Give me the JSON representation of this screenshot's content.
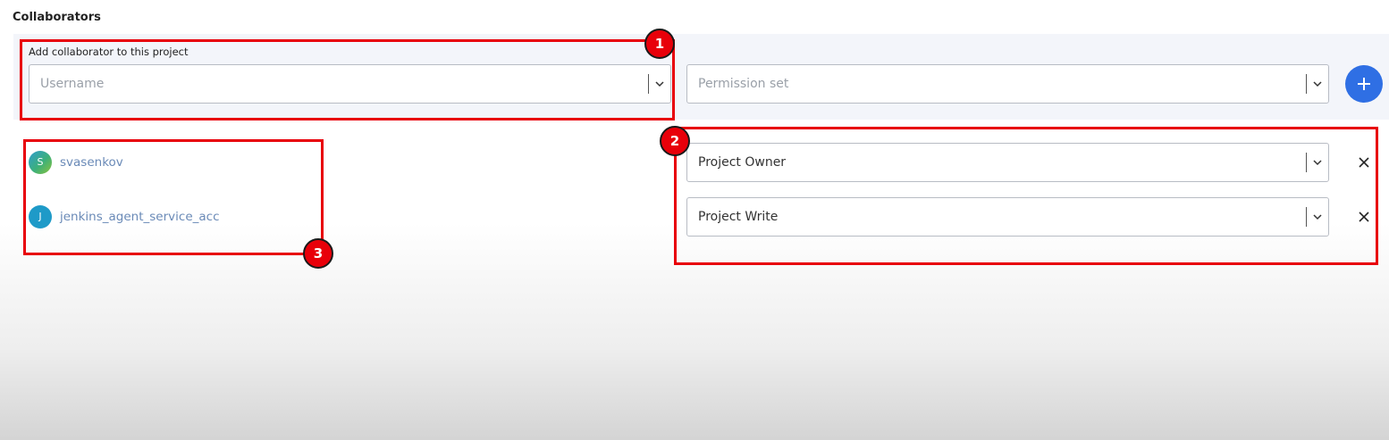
{
  "section": {
    "title": "Collaborators"
  },
  "add_form": {
    "label": "Add collaborator to this project",
    "username_placeholder": "Username",
    "permission_placeholder": "Permission set"
  },
  "collaborators": [
    {
      "initial": "S",
      "name": "svasenkov",
      "permission": "Project Owner"
    },
    {
      "initial": "J",
      "name": "jenkins_agent_service_acc",
      "permission": "Project Write"
    }
  ],
  "annotations": [
    "1",
    "2",
    "3"
  ],
  "colors": {
    "accent": "#2f6fe4",
    "annotation": "#e8000a",
    "link": "#6a8ab7",
    "panel": "#f3f5fa"
  },
  "icons": {
    "dropdown": "chevron-down-icon",
    "add": "plus-icon",
    "remove": "close-icon"
  }
}
